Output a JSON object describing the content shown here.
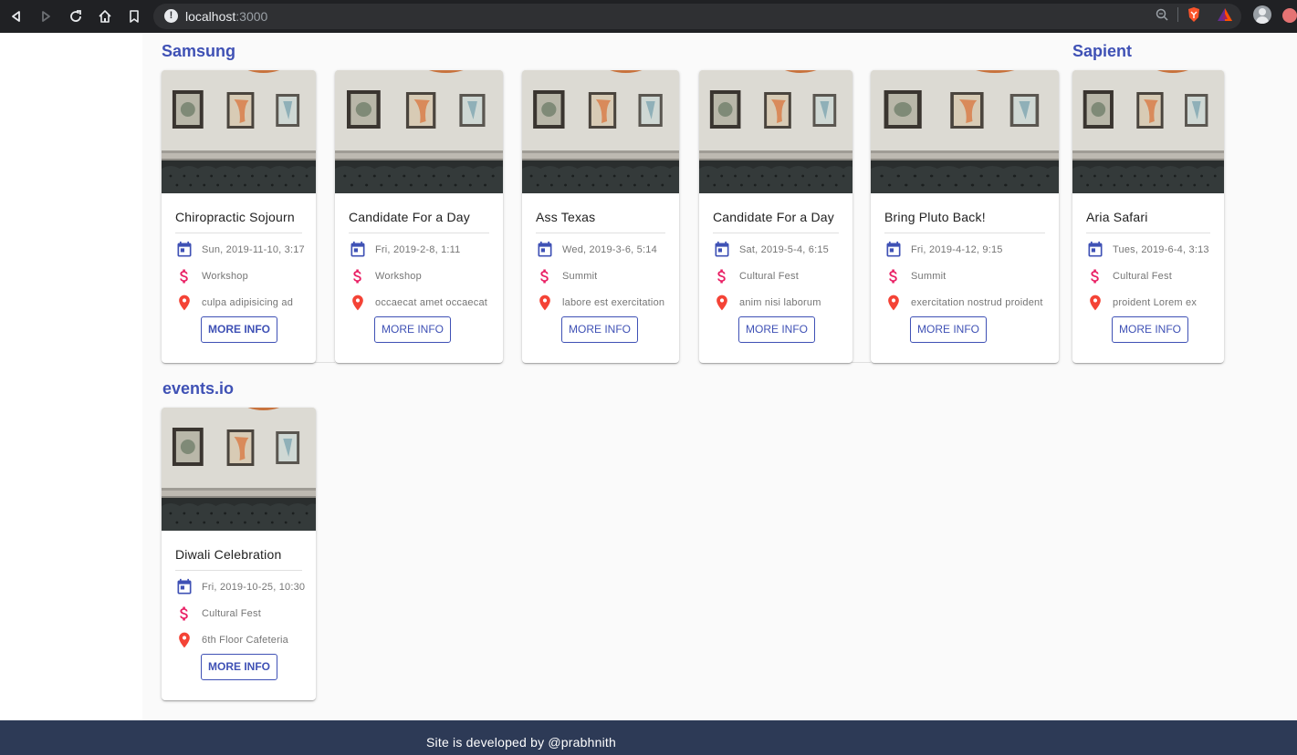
{
  "browser": {
    "url_host": "localhost",
    "url_port": ":3000",
    "info_glyph": "!"
  },
  "companies": [
    {
      "name": "Samsung",
      "events": [
        {
          "title": "Chiropractic Sojourn",
          "date": "Sun, 2019-11-10, 3:17",
          "type": "Workshop",
          "location": "culpa adipisicing ad",
          "button": "MORE INFO"
        },
        {
          "title": "Candidate For a Day",
          "date": "Fri, 2019-2-8, 1:11",
          "type": "Workshop",
          "location": "occaecat amet occaecat",
          "button": "MORE INFO"
        },
        {
          "title": "Ass Texas",
          "date": "Wed, 2019-3-6, 5:14",
          "type": "Summit",
          "location": "labore est exercitation",
          "button": "MORE INFO"
        },
        {
          "title": "Candidate For a Day",
          "date": "Sat, 2019-5-4, 6:15",
          "type": "Cultural Fest",
          "location": "anim nisi laborum",
          "button": "MORE INFO"
        },
        {
          "title": "Bring Pluto Back!",
          "date": "Fri, 2019-4-12, 9:15",
          "type": "Summit",
          "location": "exercitation nostrud proident",
          "button": "MORE INFO"
        }
      ]
    },
    {
      "name": "Sapient",
      "events": [
        {
          "title": "Aria Safari",
          "date": "Tues, 2019-6-4, 3:13",
          "type": "Cultural Fest",
          "location": "proident Lorem ex",
          "button": "MORE INFO"
        }
      ]
    },
    {
      "name": "events.io",
      "events": [
        {
          "title": "Diwali Celebration",
          "date": "Fri, 2019-10-25, 10:30",
          "type": "Cultural Fest",
          "location": "6th Floor Cafeteria",
          "button": "MORE INFO"
        }
      ]
    }
  ],
  "icons": {
    "date": "calendar-icon",
    "type": "dollar-icon",
    "location": "location-pin-icon"
  },
  "colors": {
    "accent": "#3f51b5",
    "dollar": "#e91e63",
    "pin": "#f44336",
    "footer": "#2d3a56"
  },
  "footer": {
    "text": "Site is developed by @prabhnith"
  }
}
